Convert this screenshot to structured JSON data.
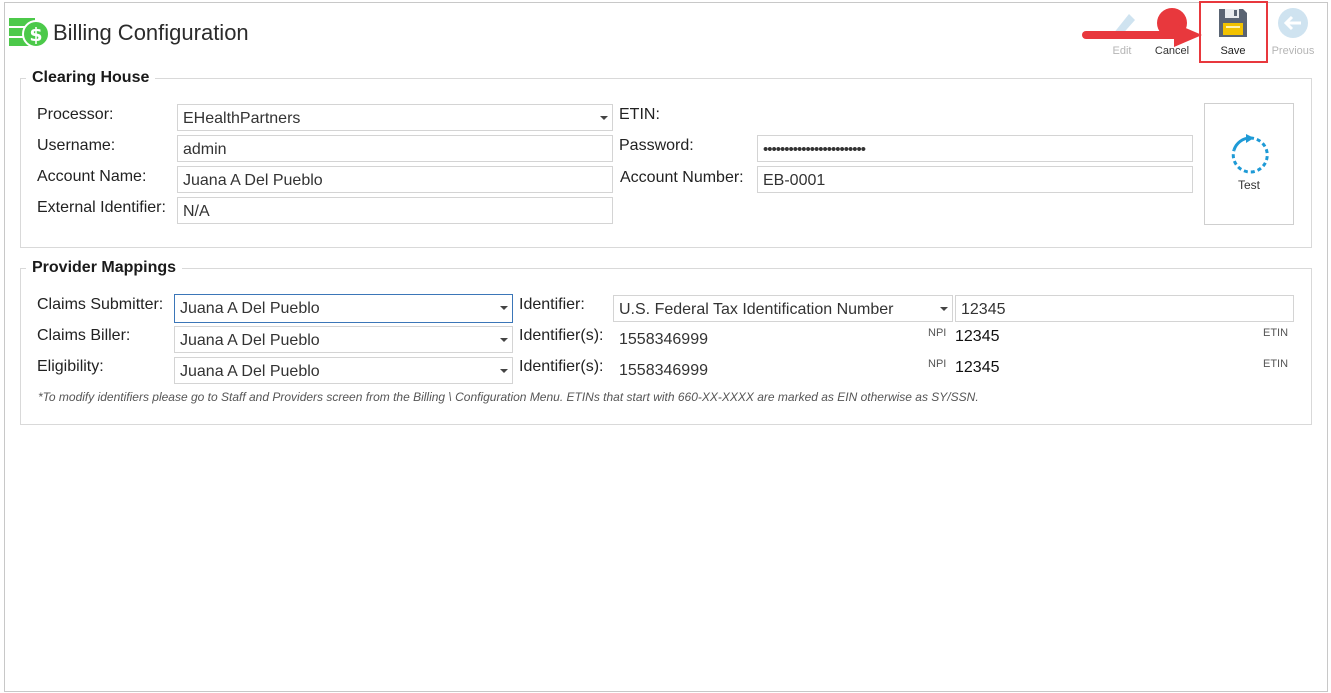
{
  "header": {
    "title": "Billing Configuration",
    "toolbar": {
      "edit_label": "Edit",
      "cancel_label": "Cancel",
      "save_label": "Save",
      "previous_label": "Previous"
    }
  },
  "clearing_house": {
    "section_title": "Clearing House",
    "processor_label": "Processor:",
    "processor_value": "EHealthPartners",
    "username_label": "Username:",
    "username_value": "admin",
    "account_name_label": "Account Name:",
    "account_name_value": "Juana A Del Pueblo",
    "external_identifier_label": "External Identifier:",
    "external_identifier_value": "N/A",
    "etin_label": "ETIN:",
    "password_label": "Password:",
    "password_value": "••••••••••••••••••••••••",
    "account_number_label": "Account Number:",
    "account_number_value": "EB-0001",
    "test_label": "Test"
  },
  "provider_mappings": {
    "section_title": "Provider Mappings",
    "claims_submitter_label": "Claims Submitter:",
    "claims_submitter_value": "Juana A Del Pueblo",
    "identifier_label": "Identifier:",
    "identifier_type_value": "U.S. Federal Tax Identification Number",
    "identifier_value": "12345",
    "claims_biller_label": "Claims Biller:",
    "claims_biller_value": "Juana A Del Pueblo",
    "biller_identifiers_label": "Identifier(s):",
    "biller_npi": "1558346999",
    "biller_npi_tag": "NPI",
    "biller_etin": "12345",
    "biller_etin_tag": "ETIN",
    "eligibility_label": "Eligibility:",
    "eligibility_value": "Juana A Del Pueblo",
    "eligibility_identifiers_label": "Identifier(s):",
    "eligibility_npi": "1558346999",
    "eligibility_npi_tag": "NPI",
    "eligibility_etin": "12345",
    "eligibility_etin_tag": "ETIN",
    "note": "*To modify identifiers please go to Staff and Providers screen from the Billing \\ Configuration Menu. ETINs that start with 660-XX-XXXX are marked as EIN otherwise as SY/SSN."
  },
  "colors": {
    "brand_green": "#4cc94a",
    "highlight_red": "#e8383d",
    "focus_blue": "#3b76b8",
    "test_icon_blue": "#1e9ad6"
  },
  "icons": [
    "money-icon",
    "edit-icon",
    "cancel-icon",
    "save-icon",
    "previous-icon",
    "refresh-icon",
    "annotation-arrow"
  ]
}
